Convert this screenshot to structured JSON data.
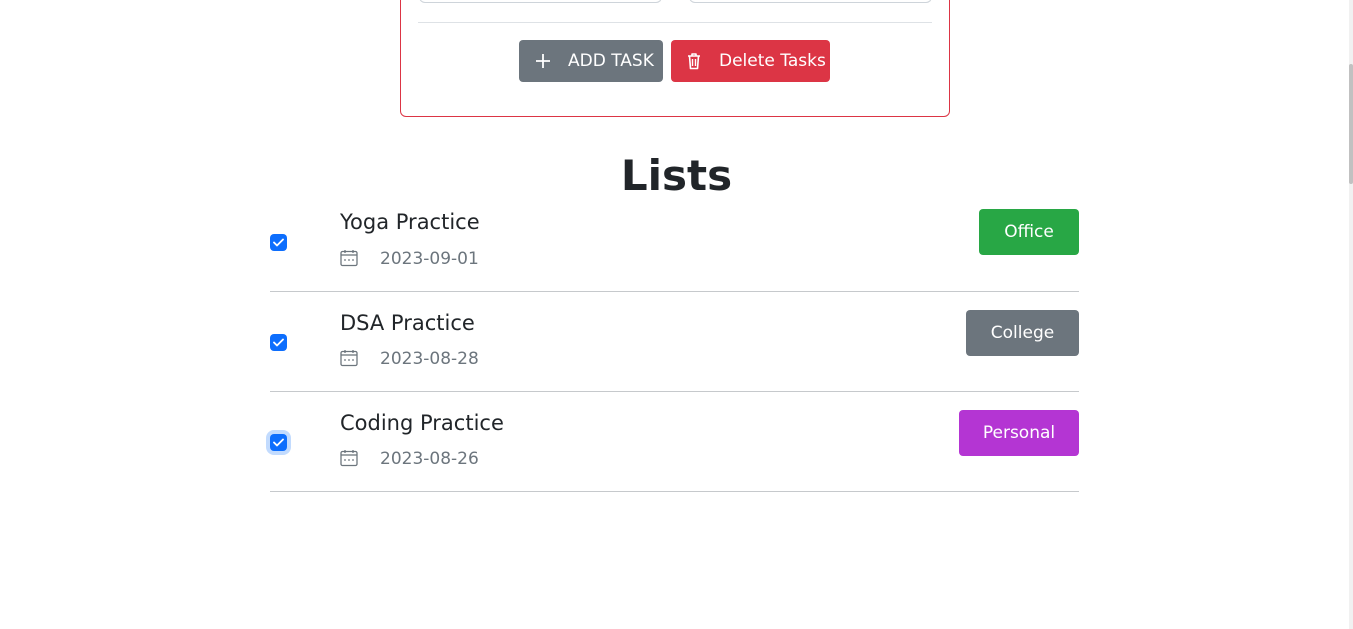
{
  "form": {
    "add_button_label": "ADD TASK",
    "delete_button_label": "Delete Tasks",
    "accent_color": "#dc3545"
  },
  "lists": {
    "title": "Lists",
    "items": [
      {
        "name": "Yoga Practice",
        "date": "2023-09-01",
        "category": "Office",
        "category_color": "#28a745",
        "checked": true
      },
      {
        "name": "DSA Practice",
        "date": "2023-08-28",
        "category": "College",
        "category_color": "#6c757d",
        "checked": true
      },
      {
        "name": "Coding Practice",
        "date": "2023-08-26",
        "category": "Personal",
        "category_color": "#b435d3",
        "checked": true
      }
    ]
  },
  "icons": {
    "add": "plus-icon",
    "delete": "trash-icon",
    "date": "calendar-icon",
    "check": "checkmark-icon"
  }
}
